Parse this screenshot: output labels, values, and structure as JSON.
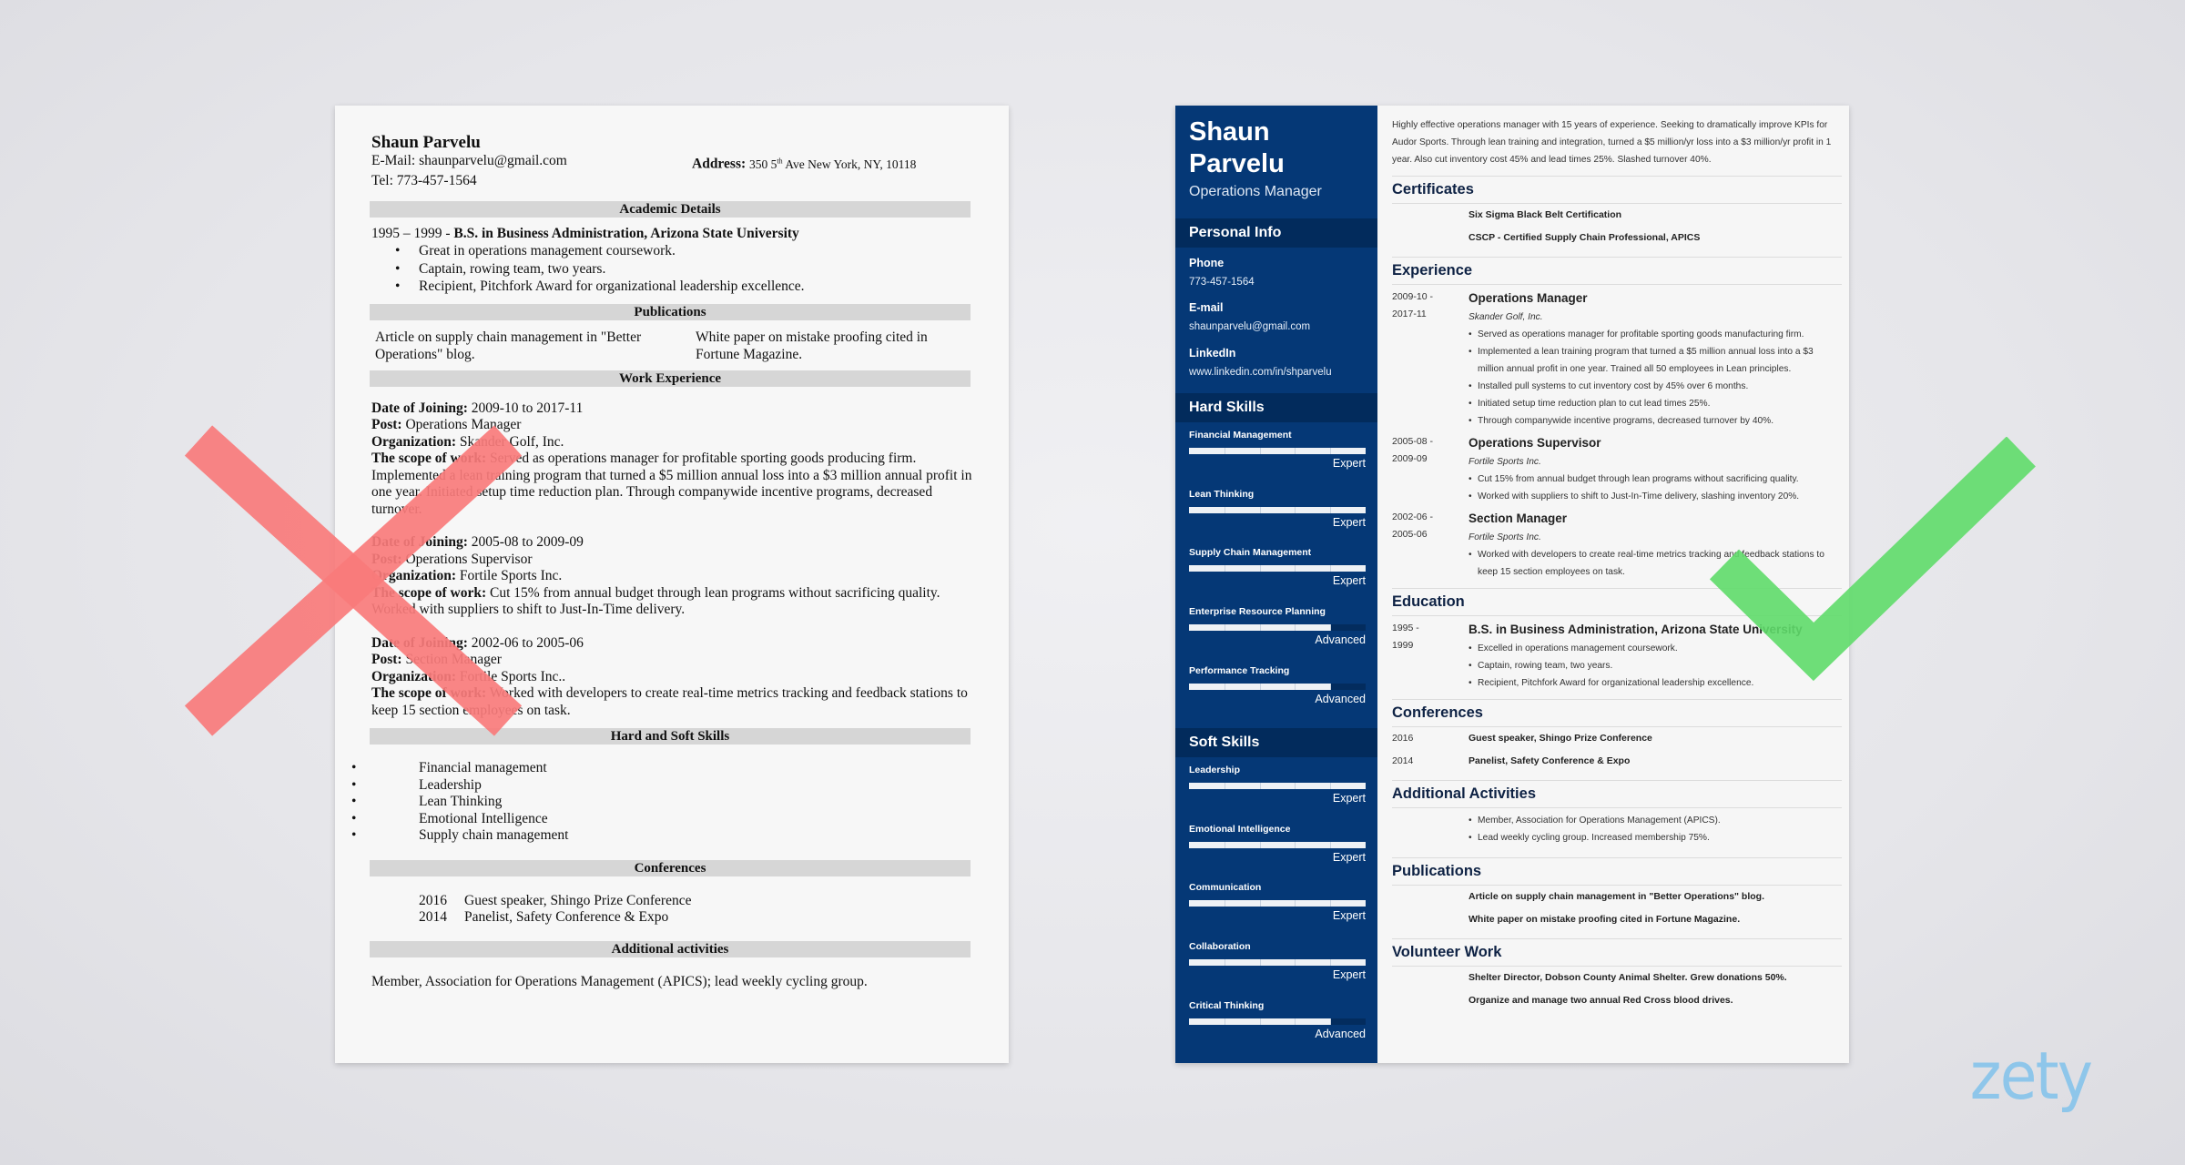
{
  "bad_resume": {
    "name": "Shaun Parvelu",
    "email_label": "E-Mail:",
    "email": "shaunparvelu@gmail.com",
    "address_label": "Address:",
    "address_pre": "350 5",
    "address_sup": "th",
    "address_post": " Ave New York, NY, 10118",
    "tel_label": "Tel:",
    "tel": "773-457-1564",
    "sections": {
      "academic": "Academic Details",
      "publications": "Publications",
      "work": "Work Experience",
      "skills": "Hard and Soft Skills",
      "conferences": "Conferences",
      "activities": "Additional activities"
    },
    "education": {
      "years": "1995 – 1999 - ",
      "degree": "B.S. in Business Administration, Arizona State University",
      "bullets": [
        "Great in operations management coursework.",
        "Captain, rowing team, two years.",
        "Recipient, Pitchfork Award for organizational leadership excellence."
      ]
    },
    "publications": [
      "Article on supply chain management in \"Better Operations\" blog.",
      "White paper on mistake proofing cited in Fortune Magazine."
    ],
    "labels": {
      "joining": "Date of Joining:",
      "post": "Post:",
      "org": "Organization:",
      "scope": "The scope of work:"
    },
    "jobs": [
      {
        "dates": "2009-10 to 2017-11",
        "post": "Operations Manager",
        "org": "Skander Golf, Inc.",
        "scope": "Served as operations manager for profitable sporting goods producing firm. Implemented a lean training program that turned a $5 million annual loss into a $3 million annual profit in one year. Initiated setup time reduction plan. Through companywide incentive programs, decreased turnover."
      },
      {
        "dates": "2005-08 to 2009-09",
        "post": "Operations Supervisor",
        "org": "Fortile Sports Inc.",
        "scope": "Cut 15% from annual budget through lean programs without sacrificing quality. Worked with suppliers to shift to Just-In-Time delivery."
      },
      {
        "dates": "2002-06 to 2005-06",
        "post": "Section Manager",
        "org": "Fortile Sports Inc..",
        "scope": "Worked with developers to create real-time metrics tracking and feedback stations to keep 15 section employees on task."
      }
    ],
    "skills": [
      "Financial management",
      "Leadership",
      "Lean Thinking",
      "Emotional Intelligence",
      "Supply chain management"
    ],
    "conferences": [
      {
        "year": "2016",
        "text": "Guest speaker, Shingo Prize Conference"
      },
      {
        "year": "2014",
        "text": "Panelist, Safety Conference & Expo"
      }
    ],
    "activities": "Member, Association for Operations Management (APICS); lead weekly cycling group."
  },
  "good_resume": {
    "first_name": "Shaun",
    "last_name": "Parvelu",
    "title": "Operations Manager",
    "personal_info": {
      "heading": "Personal Info",
      "phone_label": "Phone",
      "phone": "773-457-1564",
      "email_label": "E-mail",
      "email": "shaunparvelu@gmail.com",
      "linkedin_label": "LinkedIn",
      "linkedin": "www.linkedin.com/in/shparvelu"
    },
    "hard_skills": {
      "heading": "Hard Skills",
      "items": [
        {
          "name": "Financial Management",
          "level": "Expert",
          "fraction": 1.0
        },
        {
          "name": "Lean Thinking",
          "level": "Expert",
          "fraction": 1.0
        },
        {
          "name": "Supply Chain Management",
          "level": "Expert",
          "fraction": 1.0
        },
        {
          "name": "Enterprise Resource Planning",
          "level": "Advanced",
          "fraction": 0.8
        },
        {
          "name": "Performance Tracking",
          "level": "Advanced",
          "fraction": 0.8
        }
      ]
    },
    "soft_skills": {
      "heading": "Soft Skills",
      "items": [
        {
          "name": "Leadership",
          "level": "Expert",
          "fraction": 1.0
        },
        {
          "name": "Emotional Intelligence",
          "level": "Expert",
          "fraction": 1.0
        },
        {
          "name": "Communication",
          "level": "Expert",
          "fraction": 1.0
        },
        {
          "name": "Collaboration",
          "level": "Expert",
          "fraction": 1.0
        },
        {
          "name": "Critical Thinking",
          "level": "Advanced",
          "fraction": 0.8
        }
      ]
    },
    "summary": "Highly effective operations manager with 15 years of experience. Seeking to dramatically improve KPIs for Audor Sports. Through lean training and integration, turned a $5 million/yr loss into a $3 million/yr profit in 1 year. Also cut inventory cost 45% and lead times 25%. Slashed turnover 40%.",
    "certificates": {
      "heading": "Certificates",
      "items": [
        "Six Sigma Black Belt Certification",
        "CSCP - Certified Supply Chain Professional, APICS"
      ]
    },
    "experience": {
      "heading": "Experience",
      "items": [
        {
          "date1": "2009-10 -",
          "date2": "2017-11",
          "title": "Operations Manager",
          "org": "Skander Golf, Inc.",
          "bullets": [
            "Served as operations manager for profitable sporting goods manufacturing firm.",
            "Implemented a lean training program that turned a $5 million annual loss into a $3 million annual profit in one year. Trained all 50 employees in Lean principles.",
            "Installed pull systems to cut inventory cost by 45% over 6 months.",
            "Initiated setup time reduction plan to cut lead times 25%.",
            "Through companywide incentive programs, decreased turnover by 40%."
          ]
        },
        {
          "date1": "2005-08 -",
          "date2": "2009-09",
          "title": "Operations Supervisor",
          "org": "Fortile Sports Inc.",
          "bullets": [
            "Cut 15% from annual budget through lean programs without sacrificing quality.",
            "Worked with suppliers to shift to Just-In-Time delivery, slashing inventory 20%."
          ]
        },
        {
          "date1": "2002-06 -",
          "date2": "2005-06",
          "title": "Section Manager",
          "org": "Fortile Sports Inc.",
          "bullets": [
            "Worked with developers to create real-time metrics tracking and feedback stations to keep 15 section employees on task."
          ]
        }
      ]
    },
    "education": {
      "heading": "Education",
      "date1": "1995 -",
      "date2": "1999",
      "degree": "B.S. in Business Administration, Arizona State University",
      "bullets": [
        "Excelled in operations management coursework.",
        "Captain, rowing team, two years.",
        "Recipient, Pitchfork Award for organizational leadership excellence."
      ]
    },
    "conferences": {
      "heading": "Conferences",
      "items": [
        {
          "year": "2016",
          "text": "Guest speaker, Shingo Prize Conference"
        },
        {
          "year": "2014",
          "text": "Panelist, Safety Conference & Expo"
        }
      ]
    },
    "activities": {
      "heading": "Additional Activities",
      "items": [
        "Member, Association for Operations Management (APICS).",
        "Lead weekly cycling group. Increased membership 75%."
      ]
    },
    "publications": {
      "heading": "Publications",
      "items": [
        "Article on supply chain management in \"Better Operations\" blog.",
        "White paper on mistake proofing cited in Fortune Magazine."
      ]
    },
    "volunteer": {
      "heading": "Volunteer Work",
      "items": [
        "Shelter Director, Dobson County Animal Shelter. Grew donations 50%.",
        "Organize and manage two annual Red Cross blood drives."
      ]
    }
  },
  "overlays": {
    "bad_mark_color": "#f97b7b",
    "good_mark_color": "#5fdc6a"
  },
  "brand": {
    "logo_text": "zety",
    "logo_color": "#8ec6ea"
  }
}
